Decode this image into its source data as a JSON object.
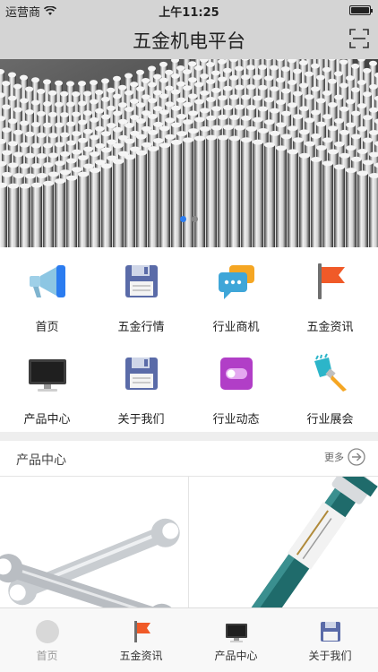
{
  "status_bar": {
    "carrier": "运营商",
    "time": "上午11:25"
  },
  "nav": {
    "title": "五金机电平台"
  },
  "banner": {
    "slides": 2,
    "active_slide": 1
  },
  "grid": [
    {
      "label": "首页",
      "icon": "megaphone-icon"
    },
    {
      "label": "五金行情",
      "icon": "floppy-disk-icon"
    },
    {
      "label": "行业商机",
      "icon": "chat-bubbles-icon"
    },
    {
      "label": "五金资讯",
      "icon": "flag-icon"
    },
    {
      "label": "产品中心",
      "icon": "monitor-icon"
    },
    {
      "label": "关于我们",
      "icon": "floppy-disk-icon"
    },
    {
      "label": "行业动态",
      "icon": "toggle-switch-icon"
    },
    {
      "label": "行业展会",
      "icon": "paint-brush-icon"
    }
  ],
  "products_section": {
    "title": "产品中心",
    "more_label": "更多"
  },
  "tabbar": [
    {
      "label": "首页",
      "icon": "home-circle-icon",
      "active": true
    },
    {
      "label": "五金资讯",
      "icon": "flag-icon"
    },
    {
      "label": "产品中心",
      "icon": "monitor-icon"
    },
    {
      "label": "关于我们",
      "icon": "floppy-disk-icon"
    }
  ],
  "colors": {
    "nav_bg": "#d4d4d4",
    "accent_blue": "#2b7cf0",
    "flag_orange": "#f05a28"
  }
}
